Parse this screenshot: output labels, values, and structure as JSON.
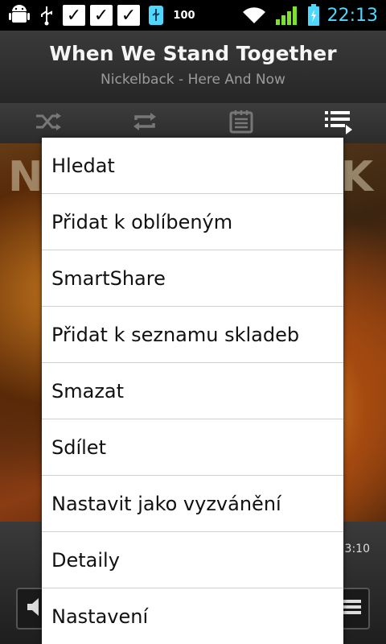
{
  "statusbar": {
    "time": "22:13",
    "battery_level": "100",
    "icons": [
      "android-icon",
      "usb-icon",
      "check-icon",
      "check-icon",
      "check-icon",
      "usb-storage-icon",
      "battery-badge-icon",
      "wifi-icon",
      "signal-icon",
      "battery-icon"
    ]
  },
  "player": {
    "title": "When We Stand Together",
    "subtitle": "Nickelback - Here And Now",
    "time_right": "3:10"
  },
  "toolbar": {
    "icons": [
      "shuffle-icon",
      "repeat-icon",
      "playlist-add-icon",
      "now-playing-list-icon"
    ]
  },
  "album": {
    "letters_left": "N",
    "letters_right": "K"
  },
  "menu": {
    "items": [
      {
        "label": "Hledat"
      },
      {
        "label": "Přidat k oblíbeným"
      },
      {
        "label": "SmartShare"
      },
      {
        "label": "Přidat k seznamu skladeb"
      },
      {
        "label": "Smazat"
      },
      {
        "label": "Sdílet"
      },
      {
        "label": "Nastavit jako vyzvánění"
      },
      {
        "label": "Detaily"
      },
      {
        "label": "Nastavení"
      }
    ]
  },
  "colors": {
    "accent_time": "#4fd8ff",
    "status_green": "#7fe030",
    "menu_bg": "#ffffff"
  }
}
